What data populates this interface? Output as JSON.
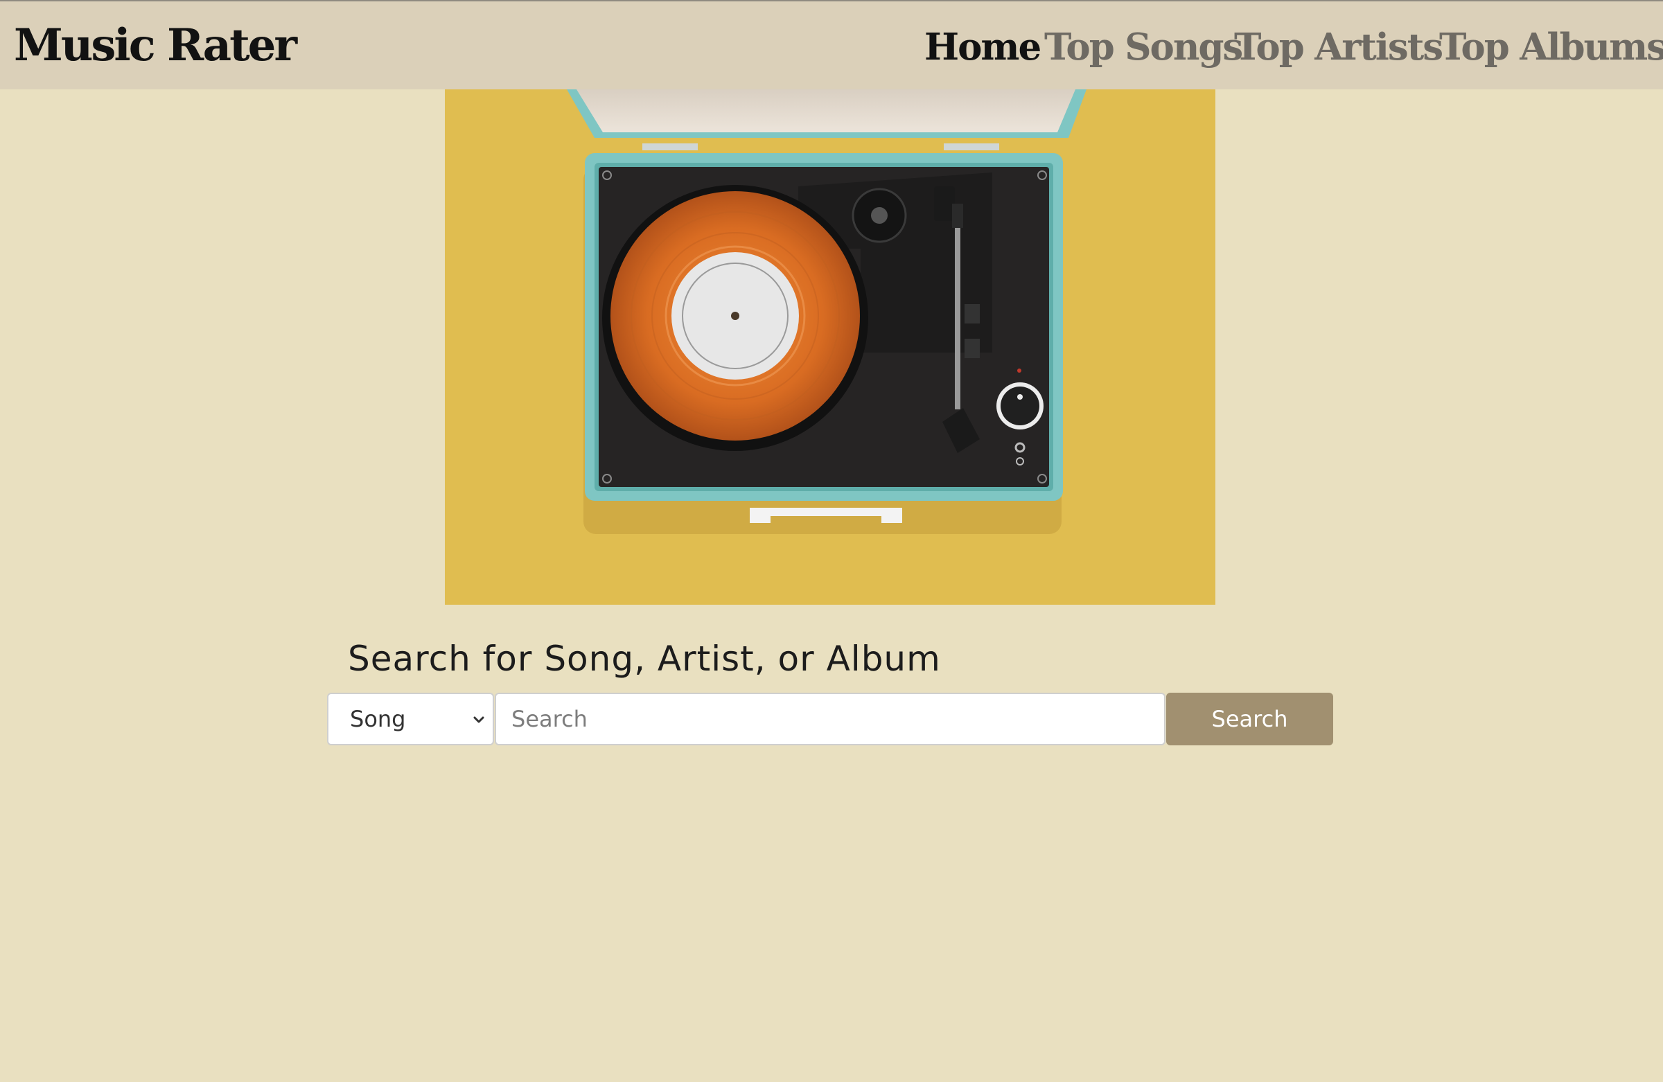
{
  "app": {
    "brand": "Music Rater"
  },
  "nav": {
    "items": [
      {
        "label": "Home",
        "active": true
      },
      {
        "label": "Top Songs",
        "active": false
      },
      {
        "label": "Top Artists",
        "active": false
      },
      {
        "label": "Top Albums",
        "active": false
      }
    ]
  },
  "hero": {
    "image_subject": "record-player",
    "colors": {
      "background": "#e0bd50",
      "case": "#7fc6c3",
      "deck": "#262424",
      "vinyl": "#e2772b",
      "label": "#e7e7e7"
    }
  },
  "search": {
    "heading": "Search for Song, Artist, or Album",
    "type_selected": "Song",
    "placeholder": "Search",
    "value": "",
    "button_label": "Search"
  },
  "theme": {
    "page_bg": "#e9e0c0",
    "header_bg": "#dbd0b9",
    "accent": "#a19070",
    "active_nav": "#121212",
    "inactive_nav": "#6e6a63"
  }
}
